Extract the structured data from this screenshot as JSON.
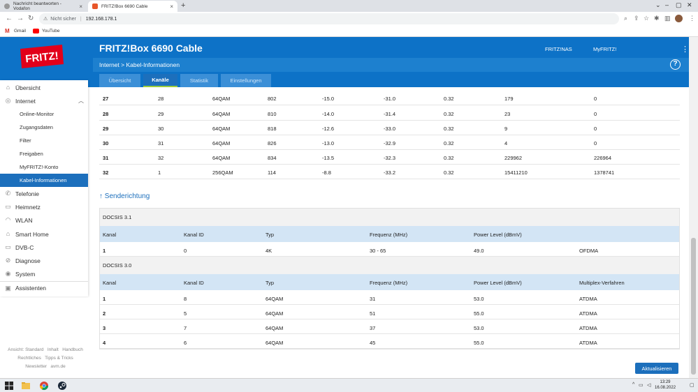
{
  "browser": {
    "tabs": [
      {
        "title": "Nachricht beantworten - Vodafon"
      },
      {
        "title": "FRITZ!Box 6690 Cable"
      }
    ],
    "address": {
      "security": "Nicht sicher",
      "url": "192.168.178.1"
    },
    "bookmarks": [
      {
        "label": "Gmail"
      },
      {
        "label": "YouTube"
      }
    ]
  },
  "header": {
    "logo_text": "FRITZ!",
    "title": "FRITZ!Box 6690 Cable",
    "links": [
      "FRITZ!NAS",
      "MyFRITZ!"
    ],
    "breadcrumb": "Internet > Kabel-Informationen",
    "help": "?",
    "tabs": [
      "Übersicht",
      "Kanäle",
      "Statistik",
      "Einstellungen"
    ]
  },
  "sidebar": {
    "items": [
      {
        "label": "Übersicht",
        "icon": "home-icon"
      },
      {
        "label": "Internet",
        "icon": "globe-icon"
      },
      {
        "label": "Online-Monitor"
      },
      {
        "label": "Zugangsdaten"
      },
      {
        "label": "Filter"
      },
      {
        "label": "Freigaben"
      },
      {
        "label": "MyFRITZ!-Konto"
      },
      {
        "label": "Kabel-Informationen"
      },
      {
        "label": "Telefonie",
        "icon": "phone-icon"
      },
      {
        "label": "Heimnetz",
        "icon": "network-icon"
      },
      {
        "label": "WLAN",
        "icon": "wifi-icon"
      },
      {
        "label": "Smart Home",
        "icon": "smarthome-icon"
      },
      {
        "label": "DVB-C",
        "icon": "tv-icon"
      },
      {
        "label": "Diagnose",
        "icon": "diagnose-icon"
      },
      {
        "label": "System",
        "icon": "system-icon"
      },
      {
        "label": "Assistenten",
        "icon": "assistant-icon"
      }
    ],
    "footer": {
      "line1": [
        "Ansicht: Standard",
        "Inhalt",
        "Handbuch"
      ],
      "line2": [
        "Rechtliches",
        "Tipps & Tricks"
      ],
      "line3": [
        "Newsletter",
        "avm.de"
      ]
    }
  },
  "receive_rows": [
    [
      "27",
      "28",
      "64QAM",
      "802",
      "-15.0",
      "-31.0",
      "0.32",
      "179",
      "0"
    ],
    [
      "28",
      "29",
      "64QAM",
      "810",
      "-14.0",
      "-31.4",
      "0.32",
      "23",
      "0"
    ],
    [
      "29",
      "30",
      "64QAM",
      "818",
      "-12.6",
      "-33.0",
      "0.32",
      "9",
      "0"
    ],
    [
      "30",
      "31",
      "64QAM",
      "826",
      "-13.0",
      "-32.9",
      "0.32",
      "4",
      "0"
    ],
    [
      "31",
      "32",
      "64QAM",
      "834",
      "-13.5",
      "-32.3",
      "0.32",
      "229962",
      "226964"
    ],
    [
      "32",
      "1",
      "256QAM",
      "114",
      "-8.8",
      "-33.2",
      "0.32",
      "15411210",
      "1378741"
    ]
  ],
  "send": {
    "heading": "↑ Senderichtung",
    "docsis31": {
      "title": "DOCSIS 3.1",
      "headers": [
        "Kanal",
        "Kanal ID",
        "Typ",
        "Frequenz (MHz)",
        "Power Level (dBmV)"
      ],
      "rows": [
        [
          "1",
          "0",
          "4K",
          "30 - 65",
          "49.0",
          "OFDMA"
        ]
      ]
    },
    "docsis30": {
      "title": "DOCSIS 3.0",
      "headers": [
        "Kanal",
        "Kanal ID",
        "Typ",
        "Frequenz (MHz)",
        "Power Level (dBmV)",
        "Multiplex-Verfahren"
      ],
      "rows": [
        [
          "1",
          "8",
          "64QAM",
          "31",
          "53.0",
          "ATDMA"
        ],
        [
          "2",
          "5",
          "64QAM",
          "51",
          "55.0",
          "ATDMA"
        ],
        [
          "3",
          "7",
          "64QAM",
          "37",
          "53.0",
          "ATDMA"
        ],
        [
          "4",
          "6",
          "64QAM",
          "45",
          "55.0",
          "ATDMA"
        ]
      ]
    }
  },
  "update_button": "Aktualisieren",
  "taskbar": {
    "time": "13:29",
    "date": "16.08.2022"
  },
  "colors": {
    "fritz_blue": "#0d72c7",
    "active_tab_underline": "#9ccc3c",
    "table_header": "#d3e5f5"
  }
}
